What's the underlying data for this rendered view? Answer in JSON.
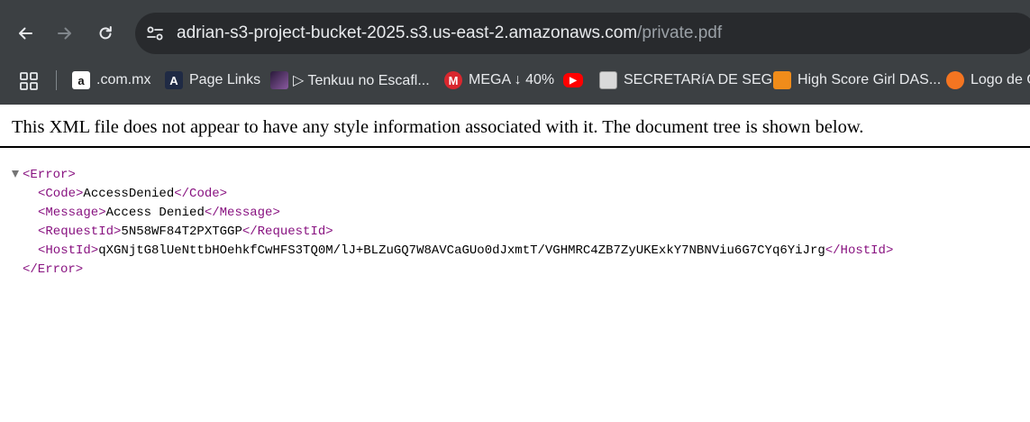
{
  "browser": {
    "url_host": "adrian-s3-project-bucket-2025.s3.us-east-2.amazonaws.com",
    "url_path": "/private.pdf"
  },
  "bookmarks": [
    {
      "label": ".com.mx",
      "icon": "amazon-icon",
      "glyph": "a",
      "color": "#ffffff"
    },
    {
      "label": "Page Links",
      "icon": "page-links-icon",
      "glyph": "A",
      "color": "#1f2a44"
    },
    {
      "label": "▷ Tenkuu no Escafl...",
      "icon": "anime-thumbnail-icon",
      "glyph": "",
      "color": "#5a3a6e"
    },
    {
      "label": "MEGA ↓ 40%",
      "icon": "mega-icon",
      "glyph": "M",
      "color": "#d9272e"
    },
    {
      "label": "",
      "icon": "youtube-icon",
      "glyph": "▶",
      "color": "#ff0000"
    },
    {
      "label": "SECRETARíA DE SEG...",
      "icon": "government-seal-icon",
      "glyph": "",
      "color": "#d9d9d9"
    },
    {
      "label": "High Score Girl DAS...",
      "icon": "manga-site-icon",
      "glyph": "",
      "color": "#f08c1a"
    },
    {
      "label": "Logo de C",
      "icon": "crunchyroll-icon",
      "glyph": "",
      "color": "#f47521"
    }
  ],
  "notice": "This XML file does not appear to have any style information associated with it. The document tree is shown below.",
  "xml": {
    "root_open": "<Error>",
    "root_close": "</Error>",
    "elements": [
      {
        "open": "<Code>",
        "value": "AccessDenied",
        "close": "</Code>"
      },
      {
        "open": "<Message>",
        "value": "Access Denied",
        "close": "</Message>"
      },
      {
        "open": "<RequestId>",
        "value": "5N58WF84T2PXTGGP",
        "close": "</RequestId>"
      },
      {
        "open": "<HostId>",
        "value": "qXGNjtG8lUeNttbHOehkfCwHFS3TQ0M/lJ+BLZuGQ7W8AVCaGUo0dJxmtT/VGHMRC4ZB7ZyUKExkY7NBNViu6G7CYq6YiJrg",
        "close": "</HostId>"
      }
    ]
  }
}
